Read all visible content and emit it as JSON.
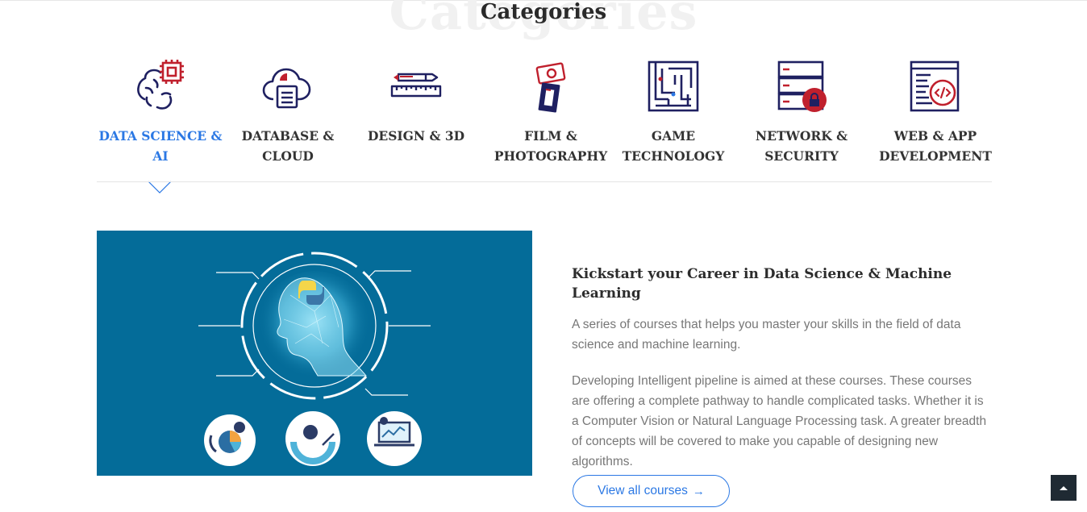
{
  "section": {
    "watermark": "Categories",
    "title": "Categories"
  },
  "tabs": [
    {
      "label": "DATA SCIENCE & AI",
      "icon": "brain-chip-icon"
    },
    {
      "label": "DATABASE & CLOUD",
      "icon": "cloud-database-icon"
    },
    {
      "label": "DESIGN & 3D",
      "icon": "pencil-ruler-icon"
    },
    {
      "label": "FILM & PHOTOGRAPHY",
      "icon": "camera-film-icon"
    },
    {
      "label": "GAME TECHNOLOGY",
      "icon": "maze-icon"
    },
    {
      "label": "NETWORK & SECURITY",
      "icon": "server-lock-icon"
    },
    {
      "label": "WEB & APP DEVELOPMENT",
      "icon": "code-window-icon"
    }
  ],
  "active_tab": 0,
  "content": {
    "heading": "Kickstart your Career in Data Science & Machine Learning",
    "paragraph1": "A series of courses that helps you master your skills in the field of data science and machine learning.",
    "paragraph2": "Developing Intelligent pipeline is aimed at these courses. These courses are offering a complete pathway to handle complicated tasks. Whether it is a Computer Vision or Natural Language Processing task. A greater breadth of concepts will be covered to make you capable of designing new algorithms.",
    "button_label": "View all courses",
    "button_arrow": "→"
  },
  "hero_image": {
    "icons": [
      "ai-head-icon",
      "python-logo-icon",
      "pie-chart-icon",
      "gauge-chart-icon",
      "laptop-analytics-icon"
    ]
  },
  "scroll_top": {
    "icon": "caret-up-icon"
  },
  "colors": {
    "accent": "#2b78e4",
    "icon_navy": "#1f2061",
    "icon_red": "#c0202d",
    "hero_bg": "#046c99",
    "heading": "#2c2c2c",
    "body_text": "#777777"
  }
}
